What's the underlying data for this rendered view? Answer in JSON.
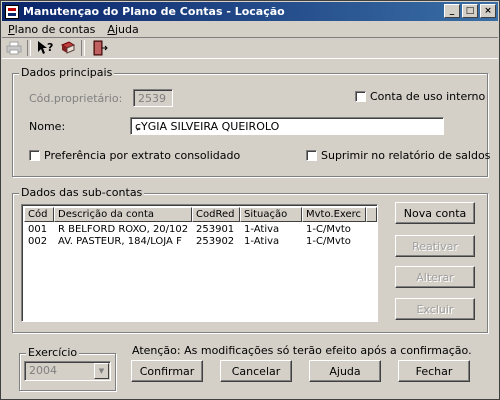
{
  "window": {
    "title": "Manutençao do Plano de Contas - Locação",
    "controls": {
      "minimize": "_",
      "maximize": "□",
      "close": "×"
    }
  },
  "menu": {
    "items": [
      {
        "mnemonic": "P",
        "rest": "lano de contas"
      },
      {
        "mnemonic": "A",
        "rest": "juda"
      }
    ]
  },
  "toolbar": {
    "icons": [
      "printer-icon",
      "help-pointer-icon",
      "books-icon",
      "exit-door-icon"
    ]
  },
  "dados_principais": {
    "title": "Dados principais",
    "cod_label": "Cód.proprietário:",
    "cod_value": "2539",
    "conta_interno_label": "Conta de uso interno",
    "nome_label": "Nome:",
    "nome_value": "ɕYGIA SILVEIRA QUEIROLO",
    "pref_label": "Preferência por extrato consolidado",
    "suprimir_label": "Suprimir no relatório de saldos"
  },
  "sub_contas": {
    "title": "Dados das sub-contas",
    "columns": [
      "Cód",
      "Descrição da conta",
      "CodRed",
      "Situação",
      "Mvto.Exerc"
    ],
    "rows": [
      [
        "001",
        "R BELFORD ROXO, 20/102",
        "253901",
        "1-Ativa",
        "1-C/Mvto"
      ],
      [
        "002",
        "AV. PASTEUR, 184/LOJA F",
        "253902",
        "1-Ativa",
        "1-C/Mvto"
      ]
    ],
    "buttons": {
      "nova": "Nova conta",
      "reativar": "Reativar",
      "alterar": "Alterar",
      "excluir": "Excluir"
    }
  },
  "exercicio": {
    "title": "Exercício",
    "value": "2004"
  },
  "footer": {
    "notice": "Atenção: As modificações só terão efeito após a confirmação.",
    "confirmar": "Confirmar",
    "cancelar": "Cancelar",
    "ajuda": "Ajuda",
    "fechar": "Fechar"
  }
}
